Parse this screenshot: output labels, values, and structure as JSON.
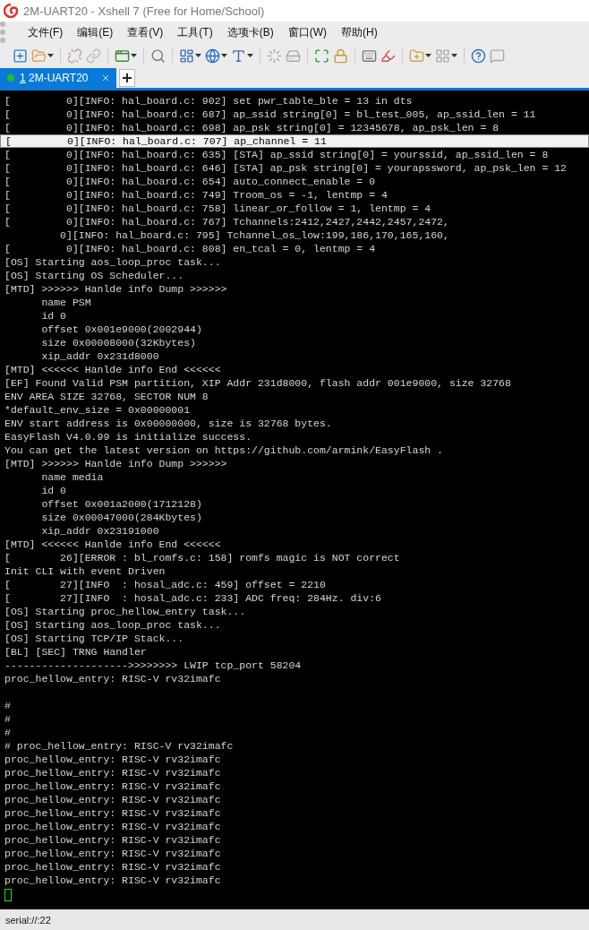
{
  "window": {
    "title": "2M-UART20 - Xshell 7 (Free for Home/School)"
  },
  "menu": [
    "文件(F)",
    "编辑(E)",
    "查看(V)",
    "工具(T)",
    "选项卡(B)",
    "窗口(W)",
    "帮助(H)"
  ],
  "tabs": [
    {
      "number": "1",
      "label": "2M-UART20",
      "selected": true,
      "connected": true
    }
  ],
  "terminal": {
    "lines": [
      {
        "text": "[         0][INFO: hal_board.c: 902] set pwr_table_ble = 13 in dts",
        "highlighted": false
      },
      {
        "text": "[         0][INFO: hal_board.c: 687] ap_ssid string[0] = bl_test_005, ap_ssid_len = 11",
        "highlighted": false
      },
      {
        "text": "[         0][INFO: hal_board.c: 698] ap_psk string[0] = 12345678, ap_psk_len = 8",
        "highlighted": false
      },
      {
        "text": "[         0][INFO: hal_board.c: 707] ap_channel = 11",
        "highlighted": true
      },
      {
        "text": "[         0][INFO: hal_board.c: 635] [STA] ap_ssid string[0] = yourssid, ap_ssid_len = 8",
        "highlighted": false
      },
      {
        "text": "[         0][INFO: hal_board.c: 646] [STA] ap_psk string[0] = yourapssword, ap_psk_len = 12",
        "highlighted": false
      },
      {
        "text": "[         0][INFO: hal_board.c: 654] auto_connect_enable = 0",
        "highlighted": false
      },
      {
        "text": "[         0][INFO: hal_board.c: 749] Troom_os = -1, lentmp = 4",
        "highlighted": false
      },
      {
        "text": "[         0][INFO: hal_board.c: 758] linear_or_follow = 1, lentmp = 4",
        "highlighted": false
      },
      {
        "text": "[         0][INFO: hal_board.c: 767] Tchannels:2412,2427,2442,2457,2472,",
        "highlighted": false
      },
      {
        "text": "         0][INFO: hal_board.c: 795] Tchannel_os_low:199,186,170,165,160,",
        "highlighted": false
      },
      {
        "text": "[         0][INFO: hal_board.c: 808] en_tcal = 0, lentmp = 4",
        "highlighted": false
      },
      {
        "text": "[OS] Starting aos_loop_proc task...",
        "highlighted": false
      },
      {
        "text": "[OS] Starting OS Scheduler...",
        "highlighted": false
      },
      {
        "text": "[MTD] >>>>>> Hanlde info Dump >>>>>>",
        "highlighted": false
      },
      {
        "text": "      name PSM",
        "highlighted": false
      },
      {
        "text": "      id 0",
        "highlighted": false
      },
      {
        "text": "      offset 0x001e9000(2002944)",
        "highlighted": false
      },
      {
        "text": "      size 0x00008000(32Kbytes)",
        "highlighted": false
      },
      {
        "text": "      xip_addr 0x231d8000",
        "highlighted": false
      },
      {
        "text": "[MTD] <<<<<< Hanlde info End <<<<<<",
        "highlighted": false
      },
      {
        "text": "[EF] Found Valid PSM partition, XIP Addr 231d8000, flash addr 001e9000, size 32768",
        "highlighted": false
      },
      {
        "text": "ENV AREA SIZE 32768, SECTOR NUM 8",
        "highlighted": false
      },
      {
        "text": "*default_env_size = 0x00000001",
        "highlighted": false
      },
      {
        "text": "ENV start address is 0x00000000, size is 32768 bytes.",
        "highlighted": false
      },
      {
        "text": "EasyFlash V4.0.99 is initialize success.",
        "highlighted": false
      },
      {
        "text": "You can get the latest version on https://github.com/armink/EasyFlash .",
        "highlighted": false
      },
      {
        "text": "[MTD] >>>>>> Hanlde info Dump >>>>>>",
        "highlighted": false
      },
      {
        "text": "      name media",
        "highlighted": false
      },
      {
        "text": "      id 0",
        "highlighted": false
      },
      {
        "text": "      offset 0x001a2000(1712128)",
        "highlighted": false
      },
      {
        "text": "      size 0x00047000(284Kbytes)",
        "highlighted": false
      },
      {
        "text": "      xip_addr 0x23191000",
        "highlighted": false
      },
      {
        "text": "[MTD] <<<<<< Hanlde info End <<<<<<",
        "highlighted": false
      },
      {
        "text": "[        26][ERROR : bl_romfs.c: 158] romfs magic is NOT correct",
        "highlighted": false
      },
      {
        "text": "Init CLI with event Driven",
        "highlighted": false
      },
      {
        "text": "[        27][INFO  : hosal_adc.c: 459] offset = 2210",
        "highlighted": false
      },
      {
        "text": "[        27][INFO  : hosal_adc.c: 233] ADC freq: 284Hz. div:6",
        "highlighted": false
      },
      {
        "text": "[OS] Starting proc_hellow_entry task...",
        "highlighted": false
      },
      {
        "text": "[OS] Starting aos_loop_proc task...",
        "highlighted": false
      },
      {
        "text": "[OS] Starting TCP/IP Stack...",
        "highlighted": false
      },
      {
        "text": "[BL] [SEC] TRNG Handler",
        "highlighted": false
      },
      {
        "text": "-------------------->>>>>>>> LWIP tcp_port 58204",
        "highlighted": false
      },
      {
        "text": "proc_hellow_entry: RISC-V rv32imafc",
        "highlighted": false
      },
      {
        "kind": "blank"
      },
      {
        "text": "#",
        "highlighted": false
      },
      {
        "text": "#",
        "highlighted": false
      },
      {
        "text": "#",
        "highlighted": false
      },
      {
        "text": "# proc_hellow_entry: RISC-V rv32imafc",
        "highlighted": false
      },
      {
        "text": "proc_hellow_entry: RISC-V rv32imafc",
        "highlighted": false
      },
      {
        "text": "proc_hellow_entry: RISC-V rv32imafc",
        "highlighted": false
      },
      {
        "text": "proc_hellow_entry: RISC-V rv32imafc",
        "highlighted": false
      },
      {
        "text": "proc_hellow_entry: RISC-V rv32imafc",
        "highlighted": false
      },
      {
        "text": "proc_hellow_entry: RISC-V rv32imafc",
        "highlighted": false
      },
      {
        "text": "proc_hellow_entry: RISC-V rv32imafc",
        "highlighted": false
      },
      {
        "text": "proc_hellow_entry: RISC-V rv32imafc",
        "highlighted": false
      },
      {
        "text": "proc_hellow_entry: RISC-V rv32imafc",
        "highlighted": false
      },
      {
        "text": "proc_hellow_entry: RISC-V rv32imafc",
        "highlighted": false
      },
      {
        "text": "proc_hellow_entry: RISC-V rv32imafc",
        "highlighted": false
      },
      {
        "kind": "cursor"
      }
    ]
  },
  "status_bar": {
    "address": "serial://:22"
  }
}
